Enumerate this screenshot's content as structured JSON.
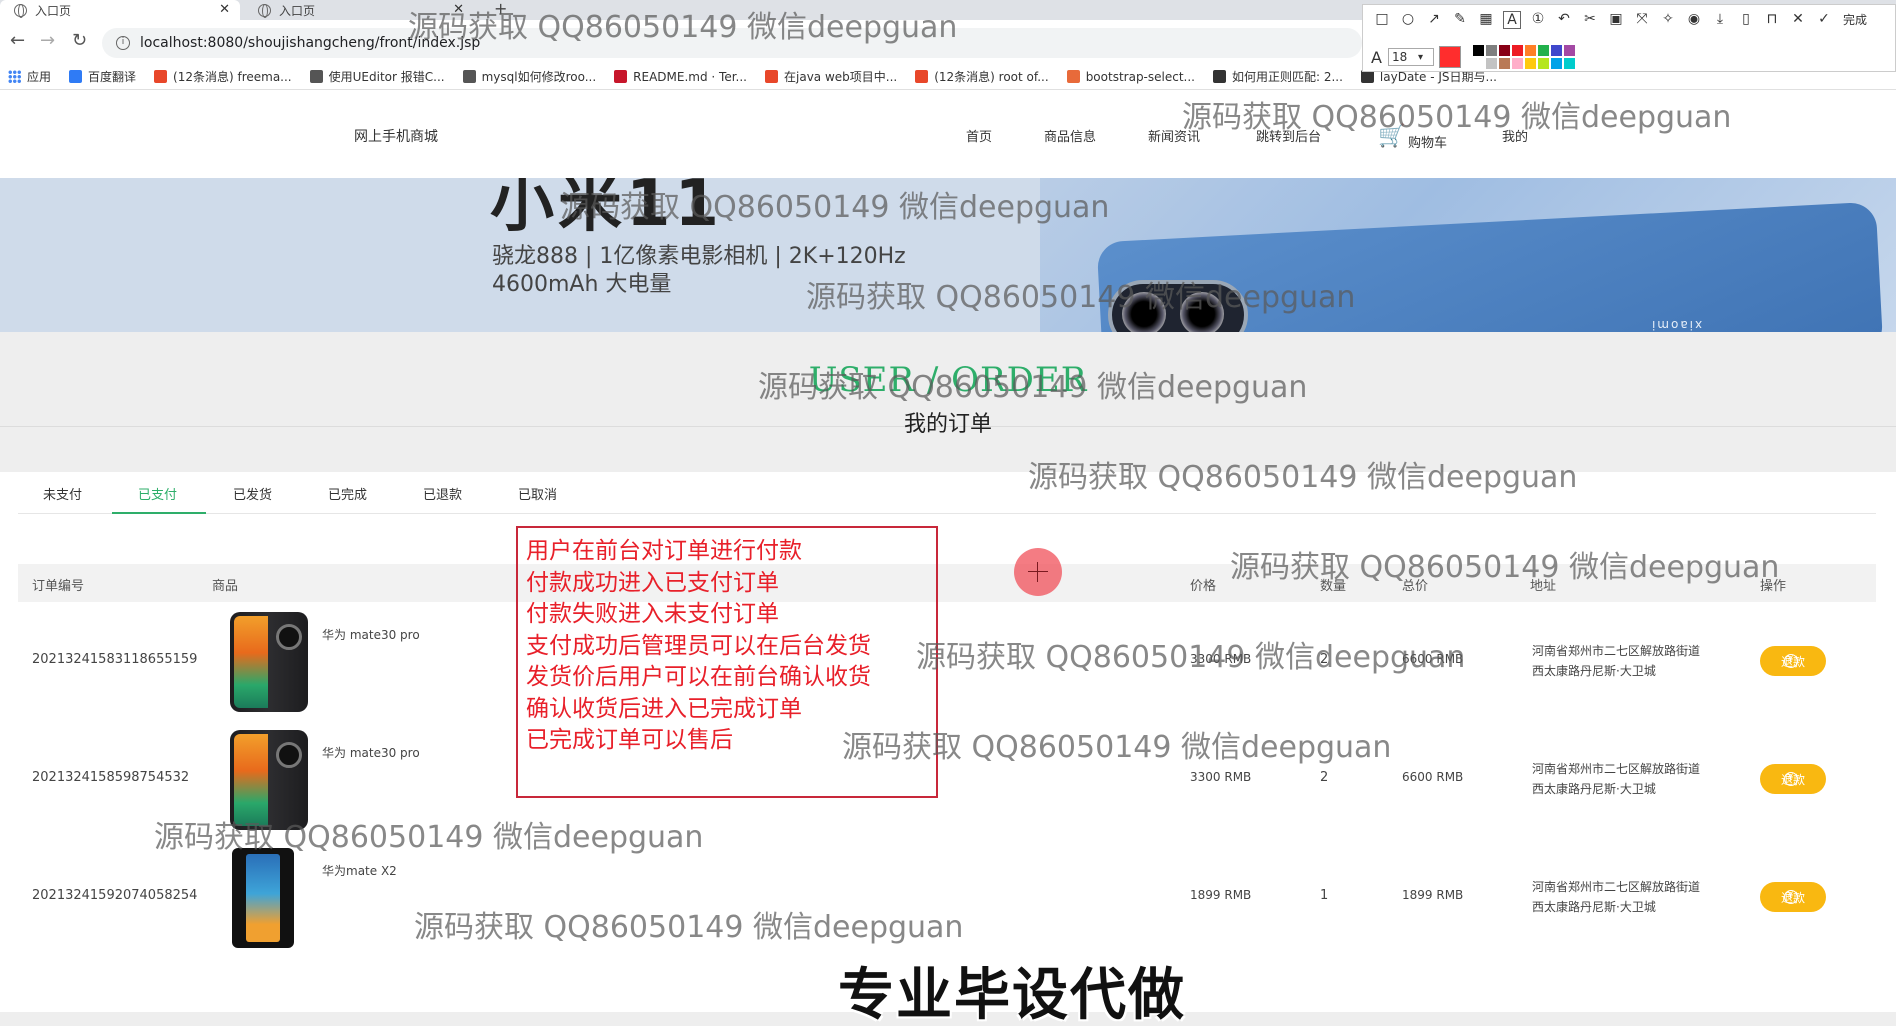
{
  "browser": {
    "tabs": [
      {
        "title": "入口页",
        "active": true
      },
      {
        "title": "入口页",
        "active": false
      }
    ],
    "url": "localhost:8080/shoujishangcheng/front/index.jsp",
    "bookmarks": [
      {
        "label": "应用",
        "color": "#4285f4"
      },
      {
        "label": "百度翻译",
        "color": "#2f7bf5"
      },
      {
        "label": "(12条消息) freema...",
        "color": "#e8472a"
      },
      {
        "label": "使用UEditor 报错C...",
        "color": "#555555"
      },
      {
        "label": "mysql如何修改roo...",
        "color": "#555555"
      },
      {
        "label": "README.md · Ter...",
        "color": "#c7162b"
      },
      {
        "label": "在java web项目中...",
        "color": "#e8472a"
      },
      {
        "label": "(12条消息) root of...",
        "color": "#e8472a"
      },
      {
        "label": "bootstrap-select...",
        "color": "#e86a3a"
      },
      {
        "label": "如何用正则匹配: 2...",
        "color": "#333333"
      },
      {
        "label": "layDate - JS日期与...",
        "color": "#333333"
      }
    ]
  },
  "snip_toolbar": {
    "font_size": "18",
    "done_label": "完成",
    "current_color": "#ff2d2d",
    "palette": [
      "#000000",
      "#7f7f7f",
      "#880015",
      "#ed1c24",
      "#ff7f27",
      "#22b14c",
      "#3f48cc",
      "#a349a4",
      "#ffffff",
      "#c3c3c3",
      "#b97a57",
      "#ffaec9",
      "#ffc90e",
      "#b5e61d",
      "#00a2e8",
      "#00cccc"
    ]
  },
  "site": {
    "logo": "网上手机商城",
    "nav": [
      "首页",
      "商品信息",
      "新闻资讯",
      "跳转到后台",
      "购物车",
      "我的"
    ]
  },
  "banner": {
    "title": "小米11",
    "line1": "骁龙888 | 1亿像素电影相机 | 2K+120Hz",
    "line2": "4600mAh 大电量",
    "brand": "xiaomi"
  },
  "section": {
    "title_en": "USER / ORDER",
    "title_cn": "我的订单"
  },
  "orders": {
    "tabs": [
      "未支付",
      "已支付",
      "已发货",
      "已完成",
      "已退款",
      "已取消"
    ],
    "active_tab": "已支付",
    "columns": [
      "订单编号",
      "商品",
      "价格",
      "数量",
      "总价",
      "地址",
      "操作"
    ],
    "rows": [
      {
        "order_no": "20213241583118655159",
        "product": "华为 mate30 pro",
        "price": "3300 RMB",
        "qty": "2",
        "total": "6600 RMB",
        "addr1": "河南省郑州市二七区解放路街道",
        "addr2": "西太康路丹尼斯·大卫城",
        "action": "退款",
        "img": "mate30"
      },
      {
        "order_no": "20213241585987545​32",
        "product": "华为 mate30 pro",
        "price": "3300 RMB",
        "qty": "2",
        "total": "6600 RMB",
        "addr1": "河南省郑州市二七区解放路街道",
        "addr2": "西太康路丹尼斯·大卫城",
        "action": "退款",
        "img": "mate30"
      },
      {
        "order_no": "20213241592074058254",
        "product": "华为mate X2",
        "price": "1899 RMB",
        "qty": "1",
        "total": "1899 RMB",
        "addr1": "河南省郑州市二七区解放路街道",
        "addr2": "西太康路丹尼斯·大卫城",
        "action": "退款",
        "img": "matex2"
      }
    ]
  },
  "annotation": {
    "lines": [
      "用户在前台对订单进行付款",
      "付款成功进入已支付订单",
      "付款失败进入未支付订单",
      "支付成功后管理员可以在后台发货",
      "发货价后用户可以在前台确认收货",
      "确认收货后进入已完成订单",
      "已完成订单可以售后"
    ]
  },
  "watermark": "源码获取 QQ86050149 微信deepguan",
  "caption": "专业毕设代做"
}
